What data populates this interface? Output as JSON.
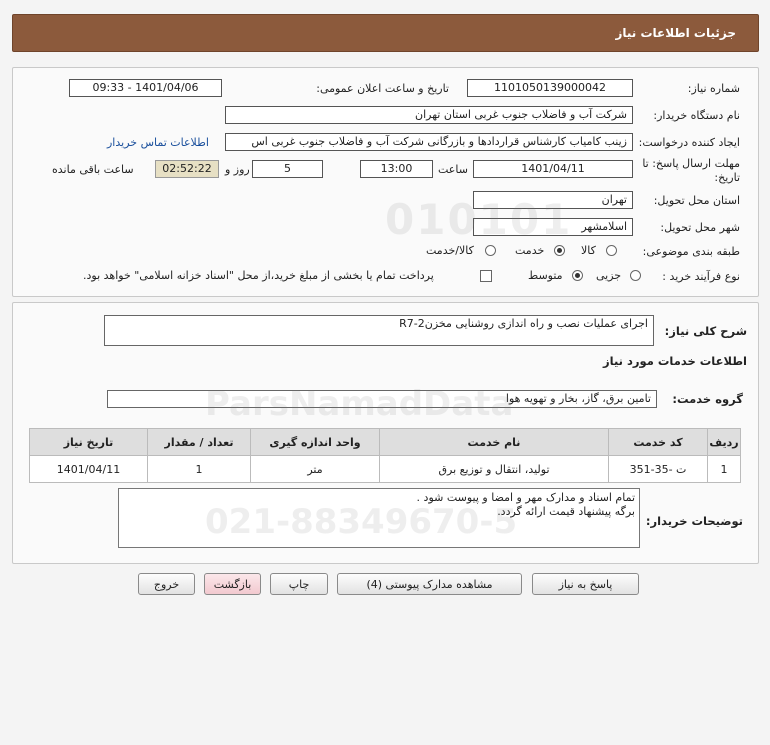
{
  "header": {
    "title": "جزئیات اطلاعات نیاز"
  },
  "details": {
    "need_number_label": "شماره نیاز:",
    "need_number": "1101050139000042",
    "announce_label": "تاریخ و ساعت اعلان عمومی:",
    "announce_value": "1401/04/06 - 09:33",
    "buyer_label": "نام دستگاه خریدار:",
    "buyer": "شرکت آب و فاضلاب جنوب غربی استان تهران",
    "creator_label": "ایجاد کننده درخواست:",
    "creator": "زینب کامیاب کارشناس قراردادها و بازرگانی شرکت آب و فاضلاب جنوب غربی اس",
    "contact_link": "اطلاعات تماس خریدار",
    "deadline_label_1": "مهلت ارسال پاسخ: تا",
    "deadline_label_2": "تاریخ:",
    "deadline_date": "1401/04/11",
    "time_label": "ساعت",
    "deadline_time": "13:00",
    "days": "5",
    "days_label": "روز و",
    "remaining": "02:52:22",
    "remaining_label": "ساعت باقی مانده",
    "province_label": "استان محل تحویل:",
    "province": "تهران",
    "city_label": "شهر محل تحویل:",
    "city": "اسلامشهر",
    "category_label": "طبقه بندی موضوعی:",
    "category_options": [
      "کالا",
      "خدمت",
      "کالا/خدمت"
    ],
    "category_selected": 1,
    "process_label": "نوع فرآیند خرید :",
    "process_options": [
      "جزیی",
      "متوسط"
    ],
    "process_selected": 1,
    "payment_text": "پرداخت تمام یا بخشی از مبلغ خرید،از محل \"اسناد خزانه اسلامی\" خواهد بود."
  },
  "summary": {
    "general_label": "شرح کلی نیاز:",
    "general": "اجرای عملیات نصب و راه اندازی روشنایی مخزنR7-2",
    "services_title": "اطلاعات خدمات مورد نیاز",
    "group_label": "گروه خدمت:",
    "group": "تامین برق، گاز، بخار و تهویه هوا",
    "table": {
      "headers": [
        "ردیف",
        "کد خدمت",
        "نام خدمت",
        "واحد اندازه گیری",
        "تعداد / مقدار",
        "تاریخ نیاز"
      ],
      "rows": [
        [
          "1",
          "ت -35-351",
          "تولید، انتقال و توزیع برق",
          "متر",
          "1",
          "1401/04/11"
        ]
      ]
    },
    "notes_label": "توضیحات خریدار:",
    "notes_line1": "تمام اسناد و مدارک مهر و امضا و پیوست شود .",
    "notes_line2": "برگه پیشنهاد قیمت ارائه گردد."
  },
  "buttons": {
    "reply": "پاسخ به نیاز",
    "attachments": "مشاهده مدارک پیوستی (4)",
    "print": "چاپ",
    "back": "بازگشت",
    "exit": "خروج"
  },
  "watermark": {
    "number": "010101",
    "brand": "ParsNamadData",
    "phone": "021-88349670-5"
  }
}
